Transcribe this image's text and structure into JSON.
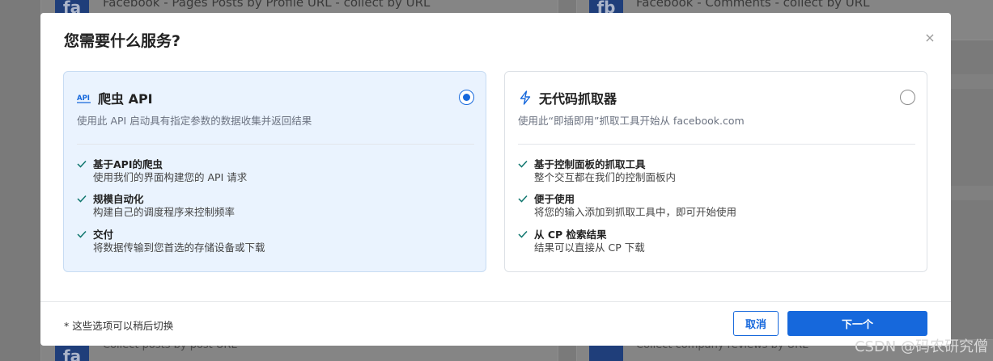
{
  "background": {
    "cards": [
      {
        "logo": "fa",
        "title": "Facebook - Pages Posts by Profile URL - collect by URL"
      },
      {
        "logo": "fb",
        "title": "Facebook - Comments - collect by URL"
      }
    ],
    "bottom_cards": [
      {
        "logo": "fa",
        "subtitle": "Collect posts by post URL"
      },
      {
        "logo": "",
        "subtitle": "Collect company reviews by URL"
      }
    ]
  },
  "modal": {
    "title": "您需要什么服务?",
    "close_symbol": "×",
    "options": [
      {
        "title": "爬虫 API",
        "description": "使用此 API 启动具有指定参数的数据收集并返回结果",
        "icon": "api-icon",
        "selected": true,
        "features": [
          {
            "title": "基于API的爬虫",
            "subtitle": "使用我们的界面构建您的 API 请求"
          },
          {
            "title": "规模自动化",
            "subtitle": "构建自己的调度程序来控制频率"
          },
          {
            "title": "交付",
            "subtitle": "将数据传输到您首选的存储设备或下载"
          }
        ]
      },
      {
        "title": "无代码抓取器",
        "description": "使用此“即插即用”抓取工具开始从 facebook.com",
        "icon": "lightning-icon",
        "selected": false,
        "features": [
          {
            "title": "基于控制面板的抓取工具",
            "subtitle": "整个交互都在我们的控制面板内"
          },
          {
            "title": "便于使用",
            "subtitle": "将您的输入添加到抓取工具中，即可开始使用"
          },
          {
            "title": "从 CP 检索结果",
            "subtitle": "结果可以直接从 CP 下载"
          }
        ]
      }
    ],
    "footer_note": "* 这些选项可以稍后切换",
    "cancel_label": "取消",
    "next_label": "下一个"
  },
  "watermark": "CSDN @码农研究僧",
  "colors": {
    "primary": "#1668dc",
    "selected_bg": "#eaf3fe",
    "check": "#0f766e"
  }
}
